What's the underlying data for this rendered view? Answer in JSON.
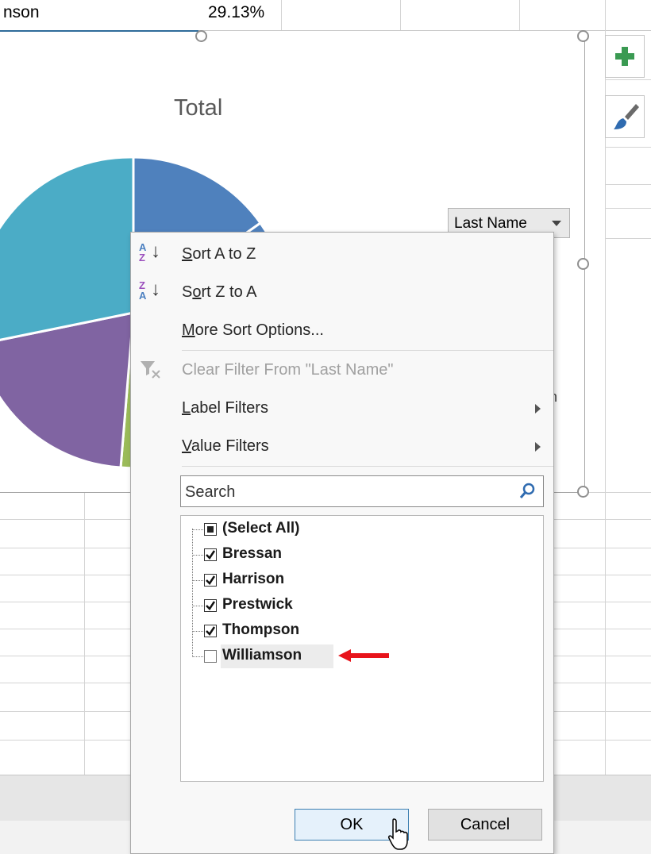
{
  "sheet": {
    "top_cell_name": "nson",
    "top_cell_value": "29.13%"
  },
  "chart": {
    "title": "Total",
    "field_button": "Last Name",
    "colors": {
      "blue": "#4f81bd",
      "teal": "#4bacc6",
      "purple": "#8064a2",
      "green": "#9bbb59"
    }
  },
  "side_buttons": {
    "add_label": "+",
    "style_icon": "paintbrush-icon"
  },
  "menu": {
    "sort_az": {
      "prefix": "",
      "accel": "S",
      "rest": "ort A to Z",
      "icon_top": "A",
      "icon_bottom": "Z"
    },
    "sort_za": {
      "prefix": "S",
      "accel": "o",
      "rest": "rt Z to A",
      "icon_top": "Z",
      "icon_bottom": "A"
    },
    "more_sort": {
      "prefix": "",
      "accel": "M",
      "rest": "ore Sort Options..."
    },
    "clear_filter": "Clear Filter From \"Last Name\"",
    "label_filters": {
      "accel": "L",
      "rest": "abel Filters"
    },
    "value_filters": {
      "accel": "V",
      "rest": "alue Filters"
    },
    "search_placeholder": "Search",
    "items": [
      {
        "label": "(Select All)",
        "state": "indeterminate"
      },
      {
        "label": "Bressan",
        "state": "checked"
      },
      {
        "label": "Harrison",
        "state": "checked"
      },
      {
        "label": "Prestwick",
        "state": "checked"
      },
      {
        "label": "Thompson",
        "state": "checked"
      },
      {
        "label": "Williamson",
        "state": "unchecked"
      }
    ],
    "ok_label": "OK",
    "cancel_label": "Cancel"
  },
  "annotation": {
    "color": "#e8141b",
    "icon": "red-arrow-icon"
  }
}
